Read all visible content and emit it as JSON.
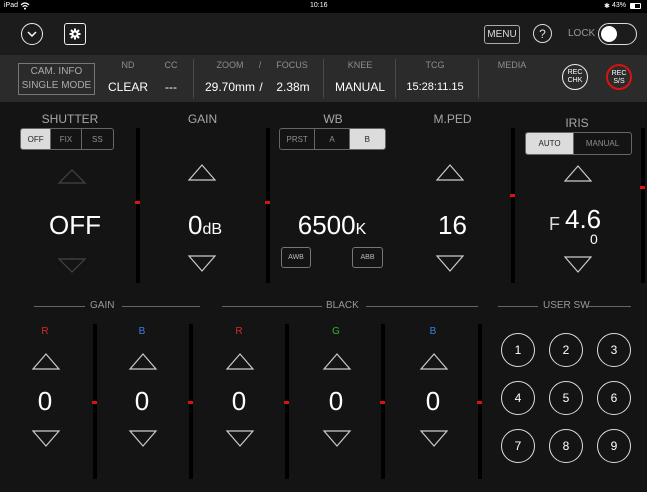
{
  "status": {
    "left": "iPad",
    "time": "10:16",
    "battery": "43%"
  },
  "toolbar": {
    "menu_label": "MENU",
    "help_label": "?",
    "lock_label": "LOCK"
  },
  "info": {
    "cam_info_line1": "CAM. INFO",
    "cam_info_line2": "SINGLE MODE",
    "nd_label": "ND",
    "nd_value": "CLEAR",
    "cc_label": "CC",
    "cc_value": "---",
    "zoom_label": "ZOOM",
    "slash": "/",
    "focus_label": "FOCUS",
    "zoom_value": "29.70mm",
    "focus_value": "2.38m",
    "knee_label": "KNEE",
    "knee_value": "MANUAL",
    "tcg_label": "TCG",
    "tcg_value": "15:28:11.15",
    "media_label": "MEDIA",
    "rec_chk_line1": "REC",
    "rec_chk_line2": "CHK",
    "rec_ss_line1": "REC",
    "rec_ss_line2": "S/S"
  },
  "shutter": {
    "title": "SHUTTER",
    "options": [
      "OFF",
      "FIX",
      "SS"
    ],
    "selected": "OFF",
    "value": "OFF"
  },
  "gain": {
    "title": "GAIN",
    "value": "0",
    "unit": "dB"
  },
  "wb": {
    "title": "WB",
    "options": [
      "PRST",
      "A",
      "B"
    ],
    "selected": "B",
    "value": "6500",
    "unit": "K",
    "awb_label": "AWB",
    "abb_label": "ABB"
  },
  "mped": {
    "title": "M.PED",
    "value": "16"
  },
  "iris": {
    "title": "IRIS",
    "options": [
      "AUTO",
      "MANUAL"
    ],
    "selected": "AUTO",
    "prefix": "F",
    "value": "4.6",
    "sub_value": "0"
  },
  "rgb_gain": {
    "title": "GAIN",
    "r_label": "R",
    "b_label": "B",
    "r_value": "0",
    "b_value": "0"
  },
  "black": {
    "title": "BLACK",
    "r_label": "R",
    "g_label": "G",
    "b_label": "B",
    "r_value": "0",
    "g_value": "0",
    "b_value": "0"
  },
  "user_sw": {
    "title": "USER SW",
    "buttons": [
      "1",
      "2",
      "3",
      "4",
      "5",
      "6",
      "7",
      "8",
      "9"
    ]
  },
  "colors": {
    "accent_red": "#d11111",
    "r_color": "#d42a2a",
    "g_color": "#2fb52f",
    "b_color": "#3a7fe0",
    "selected_bg": "#dcdcdc"
  }
}
